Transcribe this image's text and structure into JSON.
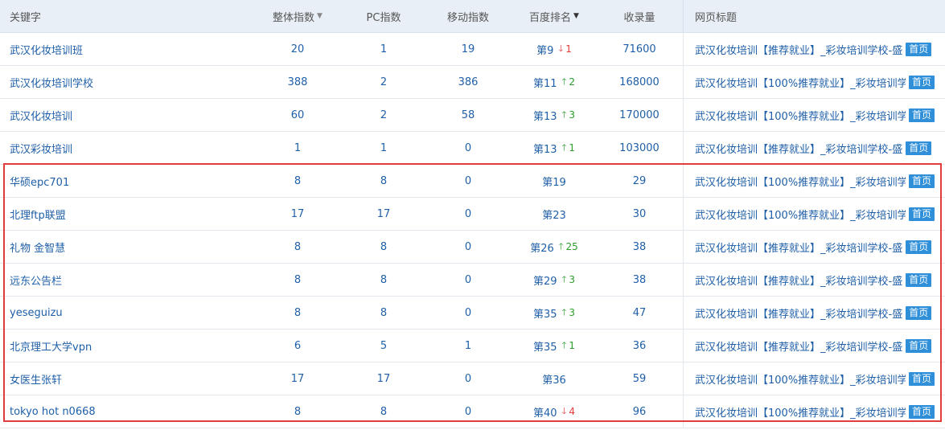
{
  "columns": {
    "keyword": "关键字",
    "total": "整体指数",
    "pc": "PC指数",
    "mobile": "移动指数",
    "rank": "百度排名",
    "count": "收录量",
    "title": "网页标题"
  },
  "colors": {
    "up": "#2a9d2a",
    "down": "#e03a3a",
    "highlight": "#e13c3c",
    "badge": "#2f8fd8"
  },
  "rows": [
    {
      "keyword": "武汉化妆培训班",
      "total": "20",
      "pc": "1",
      "mobile": "19",
      "rank": "第9",
      "change": "1",
      "dir": "down",
      "count": "71600",
      "title": "武汉化妆培训【推荐就业】_彩妆培训学校-盛",
      "badge": "首页"
    },
    {
      "keyword": "武汉化妆培训学校",
      "total": "388",
      "pc": "2",
      "mobile": "386",
      "rank": "第11",
      "change": "2",
      "dir": "up",
      "count": "168000",
      "title": "武汉化妆培训【100%推荐就业】_彩妆培训学",
      "badge": "首页"
    },
    {
      "keyword": "武汉化妆培训",
      "total": "60",
      "pc": "2",
      "mobile": "58",
      "rank": "第13",
      "change": "3",
      "dir": "up",
      "count": "170000",
      "title": "武汉化妆培训【100%推荐就业】_彩妆培训学",
      "badge": "首页"
    },
    {
      "keyword": "武汉彩妆培训",
      "total": "1",
      "pc": "1",
      "mobile": "0",
      "rank": "第13",
      "change": "1",
      "dir": "up",
      "count": "103000",
      "title": "武汉化妆培训【推荐就业】_彩妆培训学校-盛",
      "badge": "首页"
    },
    {
      "keyword": "华硕epc701",
      "total": "8",
      "pc": "8",
      "mobile": "0",
      "rank": "第19",
      "change": "",
      "dir": "",
      "count": "29",
      "title": "武汉化妆培训【100%推荐就业】_彩妆培训学",
      "badge": "首页"
    },
    {
      "keyword": "北理ftp联盟",
      "total": "17",
      "pc": "17",
      "mobile": "0",
      "rank": "第23",
      "change": "",
      "dir": "",
      "count": "30",
      "title": "武汉化妆培训【100%推荐就业】_彩妆培训学",
      "badge": "首页"
    },
    {
      "keyword": "礼物 金智慧",
      "total": "8",
      "pc": "8",
      "mobile": "0",
      "rank": "第26",
      "change": "25",
      "dir": "up",
      "count": "38",
      "title": "武汉化妆培训【推荐就业】_彩妆培训学校-盛",
      "badge": "首页"
    },
    {
      "keyword": "远东公告栏",
      "total": "8",
      "pc": "8",
      "mobile": "0",
      "rank": "第29",
      "change": "3",
      "dir": "up",
      "count": "38",
      "title": "武汉化妆培训【推荐就业】_彩妆培训学校-盛",
      "badge": "首页"
    },
    {
      "keyword": "yeseguizu",
      "total": "8",
      "pc": "8",
      "mobile": "0",
      "rank": "第35",
      "change": "3",
      "dir": "up",
      "count": "47",
      "title": "武汉化妆培训【推荐就业】_彩妆培训学校-盛",
      "badge": "首页"
    },
    {
      "keyword": "北京理工大学vpn",
      "total": "6",
      "pc": "5",
      "mobile": "1",
      "rank": "第35",
      "change": "1",
      "dir": "up",
      "count": "36",
      "title": "武汉化妆培训【推荐就业】_彩妆培训学校-盛",
      "badge": "首页"
    },
    {
      "keyword": "女医生张轩",
      "total": "17",
      "pc": "17",
      "mobile": "0",
      "rank": "第36",
      "change": "",
      "dir": "",
      "count": "59",
      "title": "武汉化妆培训【100%推荐就业】_彩妆培训学",
      "badge": "首页"
    },
    {
      "keyword": "tokyo hot n0668",
      "total": "8",
      "pc": "8",
      "mobile": "0",
      "rank": "第40",
      "change": "4",
      "dir": "down",
      "count": "96",
      "title": "武汉化妆培训【100%推荐就业】_彩妆培训学",
      "badge": "首页"
    }
  ]
}
